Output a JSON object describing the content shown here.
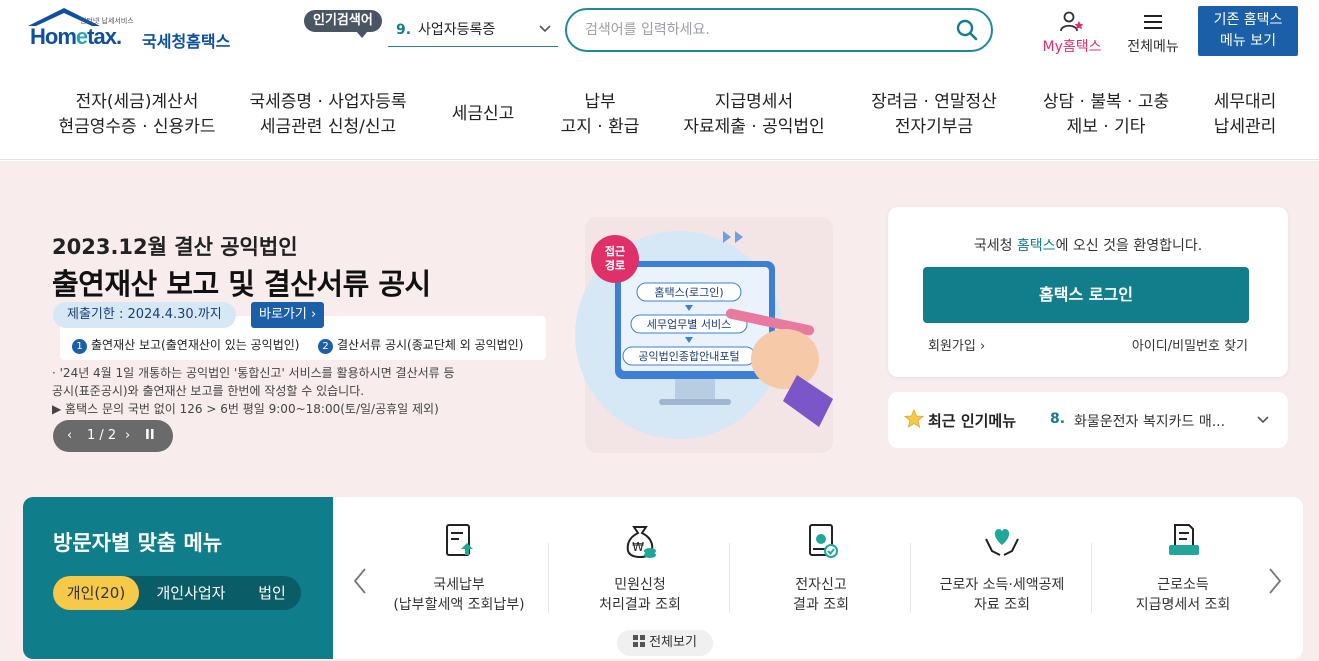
{
  "header": {
    "logo_sub": "인터넷 납세서비스",
    "logo_word_a": "Hom",
    "logo_word_b": "e",
    "logo_word_c": "tax.",
    "logo_kr": "국세청홈택스",
    "popular_tag": "인기검색어",
    "popular_num": "9.",
    "popular_text": "사업자등록증",
    "search_placeholder": "검색어를 입력하세요.",
    "myhome_label": "My홈택스",
    "allmenu_label": "전체메뉴",
    "legacy_line1": "기존 홈택스",
    "legacy_line2": "메뉴 보기"
  },
  "gnb": [
    {
      "l1": "전자(세금)계산서",
      "l2": "현금영수증 · 신용카드"
    },
    {
      "l1": "국세증명 · 사업자등록",
      "l2": "세금관련 신청/신고"
    },
    {
      "l1": "세금신고",
      "l2": ""
    },
    {
      "l1": "납부",
      "l2": "고지 · 환급"
    },
    {
      "l1": "지급명세서",
      "l2": "자료제출 · 공익법인"
    },
    {
      "l1": "장려금 · 연말정산",
      "l2": "전자기부금"
    },
    {
      "l1": "상담 · 불복 · 고충",
      "l2": "제보 · 기타"
    },
    {
      "l1": "세무대리",
      "l2": "납세관리"
    }
  ],
  "hero": {
    "sub": "2023.12월 결산 공익법인",
    "title": "출연재산 보고 및 결산서류 공시",
    "deadline": "제출기한 : 2024.4.30.까지",
    "goto": "바로가기 ›",
    "step1_num": "1",
    "step1": "출연재산 보고(출연재산이 있는 공익법인)",
    "step2_num": "2",
    "step2": "결산서류 공시(종교단체 외 공익법인)",
    "note1": "·  '24년 4월 1일 개통하는 공익법인 '통합신고' 서비스를 활용하시면 결산서류 등",
    "note2": "   공시(표준공시)와 출연재산 보고를 한번에 작성할 수 있습니다.",
    "note3": "▶ 홈택스 문의 국번 없이 126 > 6번 평일 9:00~18:00(토/일/공휴일 제외)",
    "pager_prev": "‹",
    "pager_count": "1 / 2",
    "pager_next": "›",
    "pager_pause": "II",
    "illus_badge_1": "접근",
    "illus_badge_2": "경로",
    "illus_pill1": "홈택스(로그인)",
    "illus_pill2": "세무업무별 서비스",
    "illus_pill3": "공익법인종합안내포털"
  },
  "login": {
    "welcome_a": "국세청 ",
    "welcome_hl": "홈택스",
    "welcome_b": "에 오신 것을 환영합니다.",
    "button": "홈택스 로그인",
    "join": "회원가입 ›",
    "find": "아이디/비밀번호 찾기"
  },
  "recent": {
    "title": "최근 인기메뉴",
    "num": "8.",
    "text": "화물운전자 복지카드 매..."
  },
  "visitor": {
    "title": "방문자별 맞춤 메뉴",
    "tabs": [
      "개인(20)",
      "개인사업자",
      "법인"
    ],
    "items": [
      {
        "l1": "국세납부",
        "l2": "(납부할세액 조회납부)",
        "icon": "tax-payment-icon"
      },
      {
        "l1": "민원신청",
        "l2": "처리결과 조회",
        "icon": "money-bag-icon"
      },
      {
        "l1": "전자신고",
        "l2": "결과 조회",
        "icon": "document-check-icon"
      },
      {
        "l1": "근로자 소득·세액공제",
        "l2": "자료 조회",
        "icon": "heart-hands-icon"
      },
      {
        "l1": "근로소득",
        "l2": "지급명세서 조회",
        "icon": "paper-tray-icon"
      }
    ],
    "view_all": "전체보기"
  },
  "colors": {
    "brand": "#0f4fa2",
    "teal": "#127e8c",
    "hero_bg": "#f8eced",
    "accent_yellow": "#f7c948",
    "pink": "#e0306a"
  }
}
